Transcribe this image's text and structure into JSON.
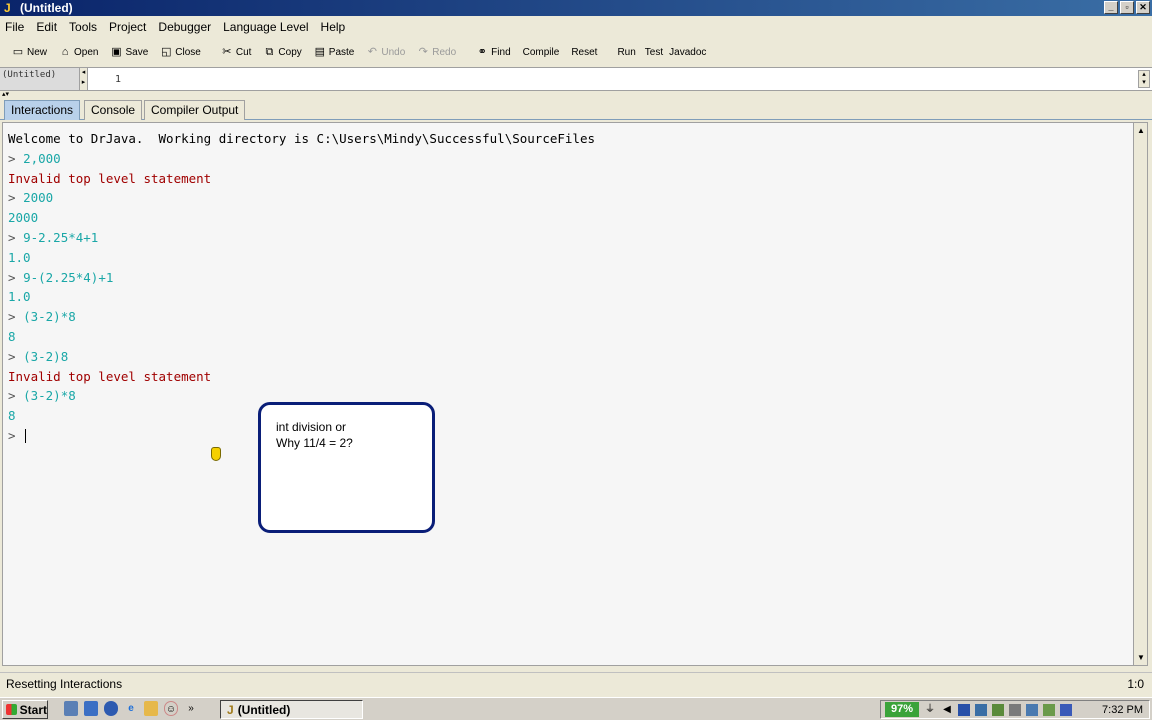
{
  "window": {
    "title": "(Untitled)",
    "buttons": [
      "_",
      "▫",
      "✕"
    ]
  },
  "menu": [
    "File",
    "Edit",
    "Tools",
    "Project",
    "Debugger",
    "Language Level",
    "Help"
  ],
  "toolbar": {
    "new": "New",
    "open": "Open",
    "save": "Save",
    "close": "Close",
    "cut": "Cut",
    "copy": "Copy",
    "paste": "Paste",
    "undo": "Undo",
    "redo": "Redo",
    "find": "Find",
    "compile": "Compile",
    "reset": "Reset",
    "run": "Run",
    "test": "Test",
    "javadoc": "Javadoc"
  },
  "document": {
    "name": "(Untitled)",
    "line_number": "1"
  },
  "tabs": [
    "Interactions",
    "Console",
    "Compiler Output"
  ],
  "console": {
    "welcome": "Welcome to DrJava.  Working directory is C:\\Users\\Mindy\\Successful\\SourceFiles",
    "lines": [
      {
        "prompt": "> ",
        "text": "2,000",
        "kind": "input"
      },
      {
        "text": "Invalid top level statement",
        "kind": "error"
      },
      {
        "prompt": "> ",
        "text": "2000",
        "kind": "input"
      },
      {
        "text": "2000",
        "kind": "output"
      },
      {
        "prompt": "> ",
        "text": "9-2.25*4+1",
        "kind": "input"
      },
      {
        "text": "1.0",
        "kind": "output"
      },
      {
        "prompt": "> ",
        "text": "9-(2.25*4)+1",
        "kind": "input"
      },
      {
        "text": "1.0",
        "kind": "output"
      },
      {
        "prompt": "> ",
        "text": "(3-2)*8",
        "kind": "input"
      },
      {
        "text": "8",
        "kind": "output"
      },
      {
        "prompt": "> ",
        "text": "(3-2)8",
        "kind": "input"
      },
      {
        "text": "Invalid top level statement",
        "kind": "error"
      },
      {
        "prompt": "> ",
        "text": "(3-2)*8",
        "kind": "input"
      },
      {
        "text": "8",
        "kind": "output"
      }
    ],
    "current_prompt": "> "
  },
  "callout": {
    "line1": "int division or",
    "line2": "Why 11/4 = 2?"
  },
  "status": {
    "message": "Resetting Interactions",
    "position": "1:0"
  },
  "taskbar": {
    "start": "Start",
    "arrows": "»",
    "task": "(Untitled)",
    "battery": "97%",
    "clock": "7:32 PM"
  }
}
